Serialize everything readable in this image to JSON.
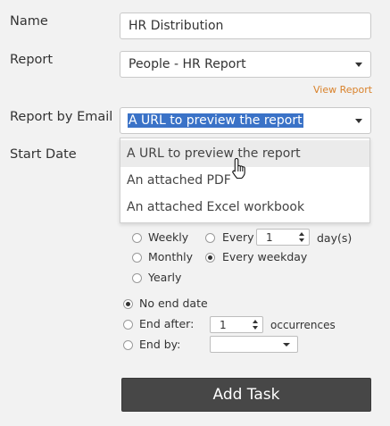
{
  "form": {
    "name_label": "Name",
    "name_value": "HR Distribution",
    "report_label": "Report",
    "report_value": "People - HR Report",
    "view_report_link": "View Report",
    "report_by_email_label": "Report by Email",
    "report_by_email_value": "A URL to preview the report",
    "start_date_label": "Start Date"
  },
  "email_dropdown": {
    "options": [
      "A URL to preview the report",
      "An attached PDF",
      "An attached Excel workbook"
    ],
    "hovered_index": 0
  },
  "recurrence": {
    "weekly": "Weekly",
    "monthly": "Monthly",
    "yearly": "Yearly",
    "every": "Every",
    "every_value": "1",
    "days_unit": "day(s)",
    "every_weekday": "Every weekday",
    "selected": "every_weekday"
  },
  "end": {
    "no_end_date": "No end date",
    "end_after": "End after:",
    "end_after_value": "1",
    "occurrences": "occurrences",
    "end_by": "End by:",
    "end_by_value": "",
    "selected": "no_end_date"
  },
  "actions": {
    "add_task": "Add Task"
  },
  "cursor": "hand-pointer-icon"
}
